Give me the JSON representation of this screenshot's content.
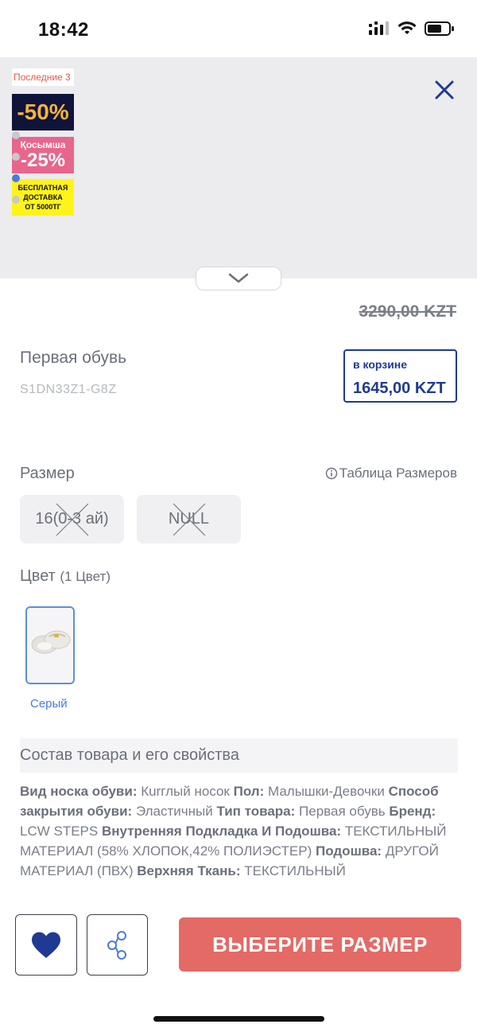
{
  "status_bar": {
    "time": "18:42",
    "icons": [
      "signal-icon",
      "wifi-icon",
      "battery-icon"
    ]
  },
  "gallery": {
    "badges": {
      "last": "Последние 3",
      "discount_main": "-50%",
      "extra_line1": "Қосымша",
      "extra_line2": "-25%",
      "free_line1": "БЕСПЛАТНАЯ",
      "free_line2": "ДОСТАВКА",
      "free_line3": "ОТ 5000ТГ"
    },
    "dots_count": 4,
    "active_dot": 3
  },
  "product": {
    "old_price": "3290,00 KZT",
    "title": "Первая обувь",
    "sku": "S1DN33Z1-G8Z",
    "cart_label": "в корзине",
    "cart_price": "1645,00 KZT"
  },
  "size": {
    "label": "Размер",
    "table_link": "Таблица Размеров",
    "options": [
      {
        "label": "16(0-3 ай)",
        "available": false
      },
      {
        "label": "NULL",
        "available": false
      }
    ]
  },
  "color": {
    "label": "Цвет",
    "count": "(1 Цвет)",
    "selected_name": "Серый"
  },
  "composition": {
    "header": "Состав товара и его свойства",
    "props": [
      {
        "k": "Вид носка обуви:",
        "v": "Кurглый носок"
      },
      {
        "k": "Пол:",
        "v": "Малышки-Девочки"
      },
      {
        "k": "Способ закрытия обуви:",
        "v": "Эластичный"
      },
      {
        "k": "Тип товара:",
        "v": "Первая обувь"
      },
      {
        "k": "Бренд:",
        "v": "LCW STEPS"
      },
      {
        "k": "Внутренняя Подкладка И Подошва:",
        "v": "ТЕКСТИЛЬНЫЙ МАТЕРИАЛ (58% ХЛОПОК,42% ПОЛИЭСТЕР)"
      },
      {
        "k": "Подошва:",
        "v": "ДРУГОЙ МАТЕРИАЛ (ПВХ)"
      },
      {
        "k": "Верхняя Ткань:",
        "v": "ТЕКСТИЛЬНЫЙ"
      }
    ]
  },
  "actions": {
    "select_size": "ВЫБЕРИТЕ РАЗМЕР"
  },
  "colors": {
    "brand_blue": "#1f3a93",
    "accent_red": "#e46a66",
    "link_blue": "#4a7ae0"
  }
}
